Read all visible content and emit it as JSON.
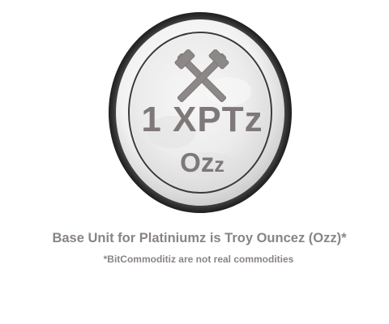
{
  "coin": {
    "amount": "1 XPTz",
    "unit_main": "Oz",
    "unit_sub": "z",
    "emblem_icon": "crossed-hammers-icon",
    "colors": {
      "text": "#7e7878",
      "rim_dark": "#3e3e3e",
      "face": "#ececec"
    }
  },
  "caption": "Base Unit for Platiniumz is Troy Ouncez (Ozz)*",
  "disclaimer": "*BitCommoditiz are not real commodities"
}
